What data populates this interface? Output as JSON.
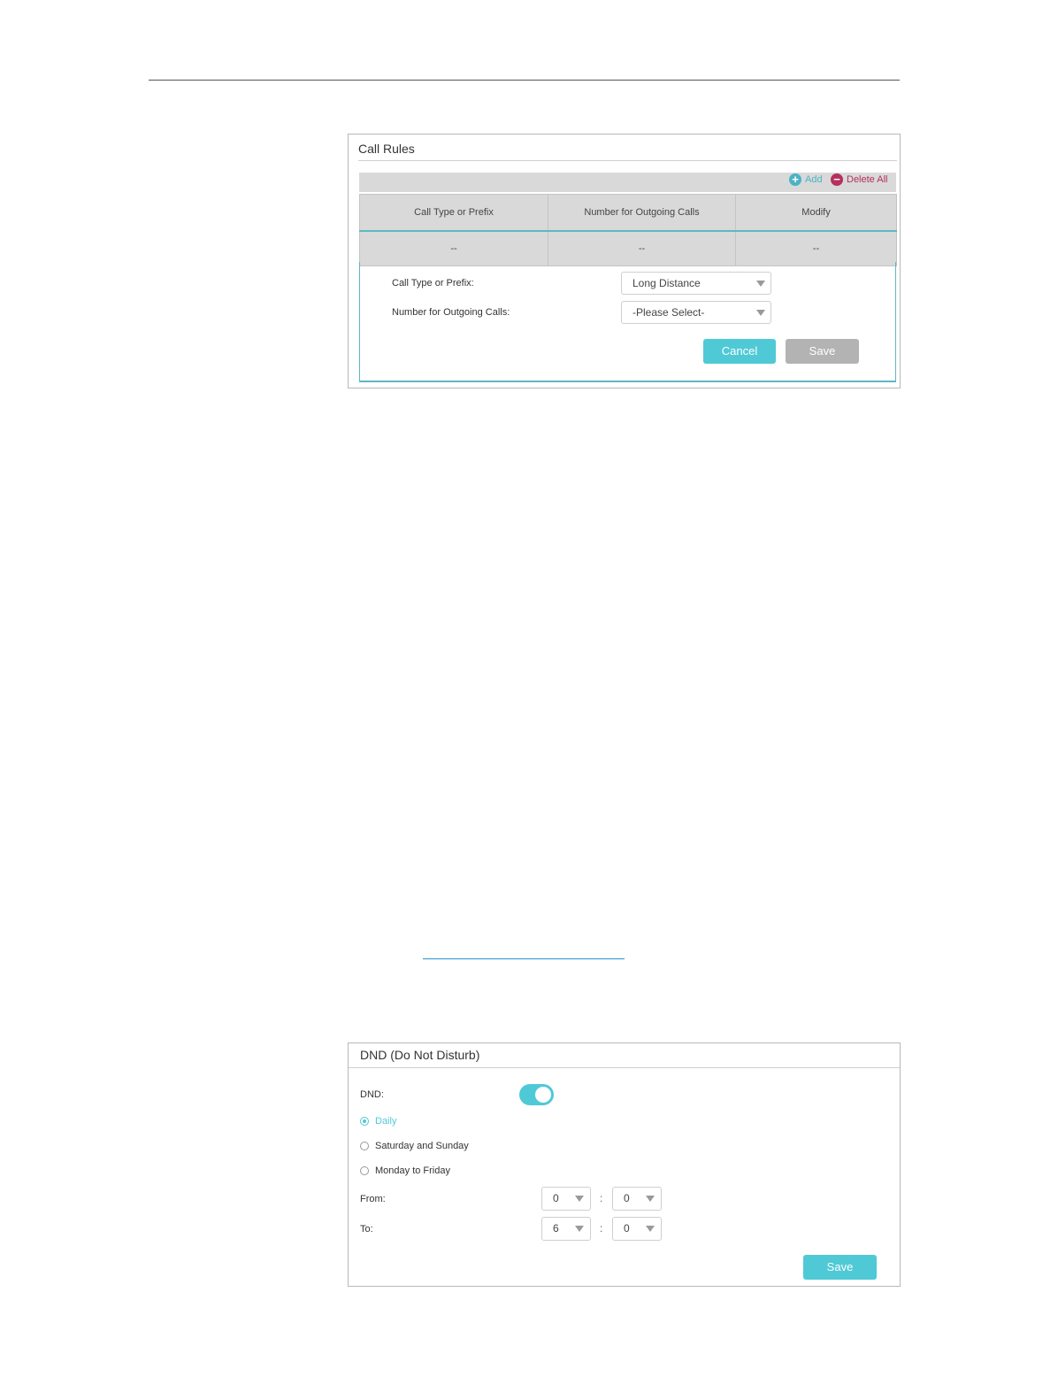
{
  "call_rules": {
    "title": "Call Rules",
    "toolbar": {
      "add_label": "Add",
      "delete_all_label": "Delete All"
    },
    "table": {
      "headers": [
        "Call Type or Prefix",
        "Number for Outgoing Calls",
        "Modify"
      ],
      "rows": [
        [
          "--",
          "--",
          "--"
        ]
      ]
    },
    "form": {
      "call_type_label": "Call Type or Prefix:",
      "call_type_value": "Long Distance",
      "outgoing_label": "Number for Outgoing Calls:",
      "outgoing_value": "-Please Select-",
      "cancel_label": "Cancel",
      "save_label": "Save"
    }
  },
  "dnd": {
    "title": "DND (Do Not Disturb)",
    "dnd_label": "DND:",
    "dnd_enabled": true,
    "options": [
      "Daily",
      "Saturday and Sunday",
      "Monday to Friday"
    ],
    "selected_option": "Daily",
    "from_label": "From:",
    "from_hour": "0",
    "from_minute": "0",
    "to_label": "To:",
    "to_hour": "6",
    "to_minute": "0",
    "separator": ":",
    "save_label": "Save"
  },
  "colors": {
    "accent": "#4fc9d6",
    "delete": "#b5305c",
    "disabled": "#b3b3b3"
  }
}
